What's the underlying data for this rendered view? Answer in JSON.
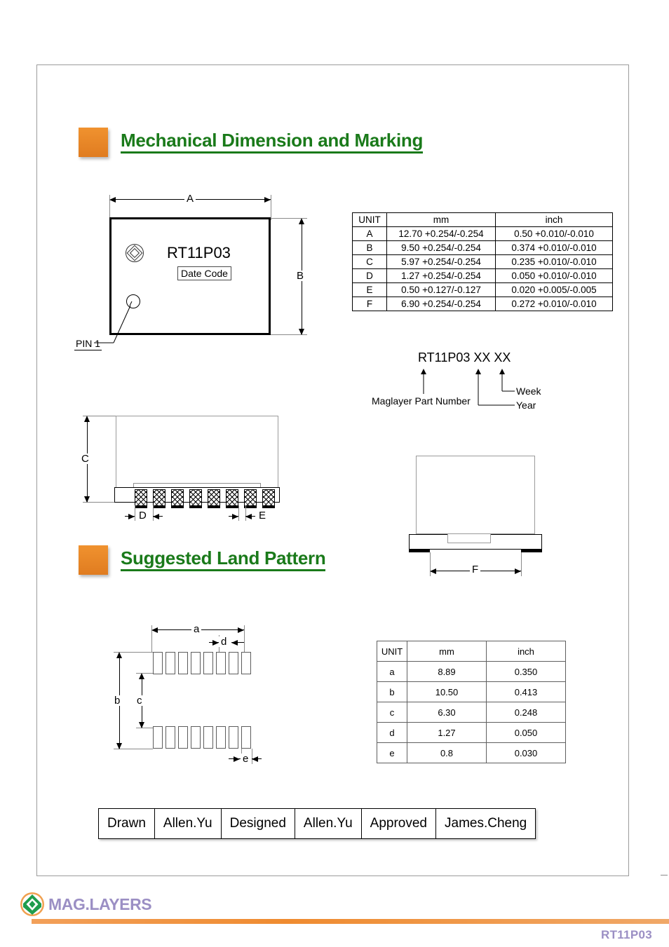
{
  "sections": {
    "mechanical": {
      "heading": "Mechanical Dimension and Marking"
    },
    "land": {
      "heading": "Suggested Land Pattern"
    }
  },
  "top_view": {
    "part_number": "RT11P03",
    "date_code_label": "Date Code",
    "pin1_label": "PIN 1",
    "dim_a": "A",
    "dim_b": "B",
    "logo_icon": "maglayers-diamond-icon"
  },
  "side_view": {
    "dim_c": "C",
    "dim_d": "D",
    "dim_e": "E",
    "pin_count": 8
  },
  "end_view": {
    "dim_f": "F"
  },
  "marking": {
    "title": "RT11P03 XX  XX",
    "part_number_label": "Maglayer Part Number",
    "year_label": "Year",
    "week_label": "Week"
  },
  "land_pattern": {
    "dim_a": "a",
    "dim_b": "b",
    "dim_c": "c",
    "dim_d": "d",
    "dim_e": "e",
    "pads_per_row": 8,
    "rows": 2
  },
  "mech_table": {
    "headers": [
      "UNIT",
      "mm",
      "inch"
    ],
    "rows": [
      {
        "unit": "A",
        "mm": "12.70 +0.254/-0.254",
        "inch": "0.50 +0.010/-0.010"
      },
      {
        "unit": "B",
        "mm": "9.50 +0.254/-0.254",
        "inch": "0.374 +0.010/-0.010"
      },
      {
        "unit": "C",
        "mm": "5.97 +0.254/-0.254",
        "inch": "0.235 +0.010/-0.010"
      },
      {
        "unit": "D",
        "mm": "1.27 +0.254/-0.254",
        "inch": "0.050 +0.010/-0.010"
      },
      {
        "unit": "E",
        "mm": "0.50 +0.127/-0.127",
        "inch": "0.020 +0.005/-0.005"
      },
      {
        "unit": "F",
        "mm": "6.90 +0.254/-0.254",
        "inch": "0.272 +0.010/-0.010"
      }
    ]
  },
  "land_table": {
    "headers": [
      "UNIT",
      "mm",
      "inch"
    ],
    "rows": [
      {
        "unit": "a",
        "mm": "8.89",
        "inch": "0.350"
      },
      {
        "unit": "b",
        "mm": "10.50",
        "inch": "0.413"
      },
      {
        "unit": "c",
        "mm": "6.30",
        "inch": "0.248"
      },
      {
        "unit": "d",
        "mm": "1.27",
        "inch": "0.050"
      },
      {
        "unit": "e",
        "mm": "0.8",
        "inch": "0.030"
      }
    ]
  },
  "signature_table": {
    "cells": [
      {
        "label": "Drawn",
        "value": "Allen.Yu"
      },
      {
        "label": "Designed",
        "value": "Allen.Yu"
      },
      {
        "label": "Approved",
        "value": "James.Cheng"
      }
    ]
  },
  "footer": {
    "company": "MAG.LAYERS",
    "part_number": "RT11P03",
    "logo_icon": "maglayers-circle-icon"
  },
  "colors": {
    "heading_green": "#1a7a1a",
    "accent_orange": "#ef8b30",
    "brand_purple": "#9b8fc4",
    "logo_green": "#1f9d4d"
  }
}
